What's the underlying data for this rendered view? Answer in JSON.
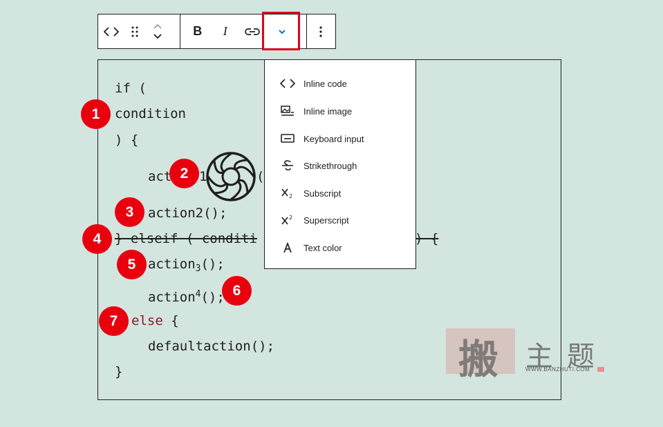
{
  "toolbar": {
    "code_icon": "code-icon",
    "drag_icon": "drag-handle-icon",
    "move_up_icon": "chevron-up-icon",
    "move_down_icon": "chevron-down-icon",
    "bold_label": "B",
    "italic_label": "I",
    "link_icon": "link-icon",
    "more_rich_text_icon": "chevron-down-icon",
    "options_icon": "more-vertical-icon"
  },
  "code_lines": {
    "l1": "if (",
    "l2": "condition",
    "l3": ") {",
    "l4a": "act",
    "l4b": "1",
    "l4c": "(",
    "l5": "action2();",
    "l6a": "} elseif ( conditi",
    "l6b": ") {",
    "l7a": "action",
    "l7sub": "3",
    "l7b": "();",
    "l8a": "action",
    "l8sup": "4",
    "l8b": "();",
    "l9a": "else",
    "l9b": " {",
    "l10": "defaultaction();",
    "l11": "}"
  },
  "badges": [
    "1",
    "2",
    "3",
    "4",
    "5",
    "6",
    "7"
  ],
  "menu": {
    "items": [
      {
        "label": "Inline code",
        "icon": "code-icon"
      },
      {
        "label": "Inline image",
        "icon": "image-icon"
      },
      {
        "label": "Keyboard input",
        "icon": "keyboard-icon"
      },
      {
        "label": "Strikethrough",
        "icon": "strikethrough-icon"
      },
      {
        "label": "Subscript",
        "icon": "subscript-icon"
      },
      {
        "label": "Superscript",
        "icon": "superscript-icon"
      },
      {
        "label": "Text color",
        "icon": "text-color-icon"
      }
    ]
  },
  "watermark": {
    "char1": "搬",
    "char2": "主",
    "char3": "题",
    "url": "WWW.BANZHUTI.COM"
  },
  "colors": {
    "background": "#d3e5df",
    "accent": "#007cba",
    "highlight": "#e0001b",
    "badge": "#e8000f",
    "else_keyword": "#8b1a2b"
  }
}
